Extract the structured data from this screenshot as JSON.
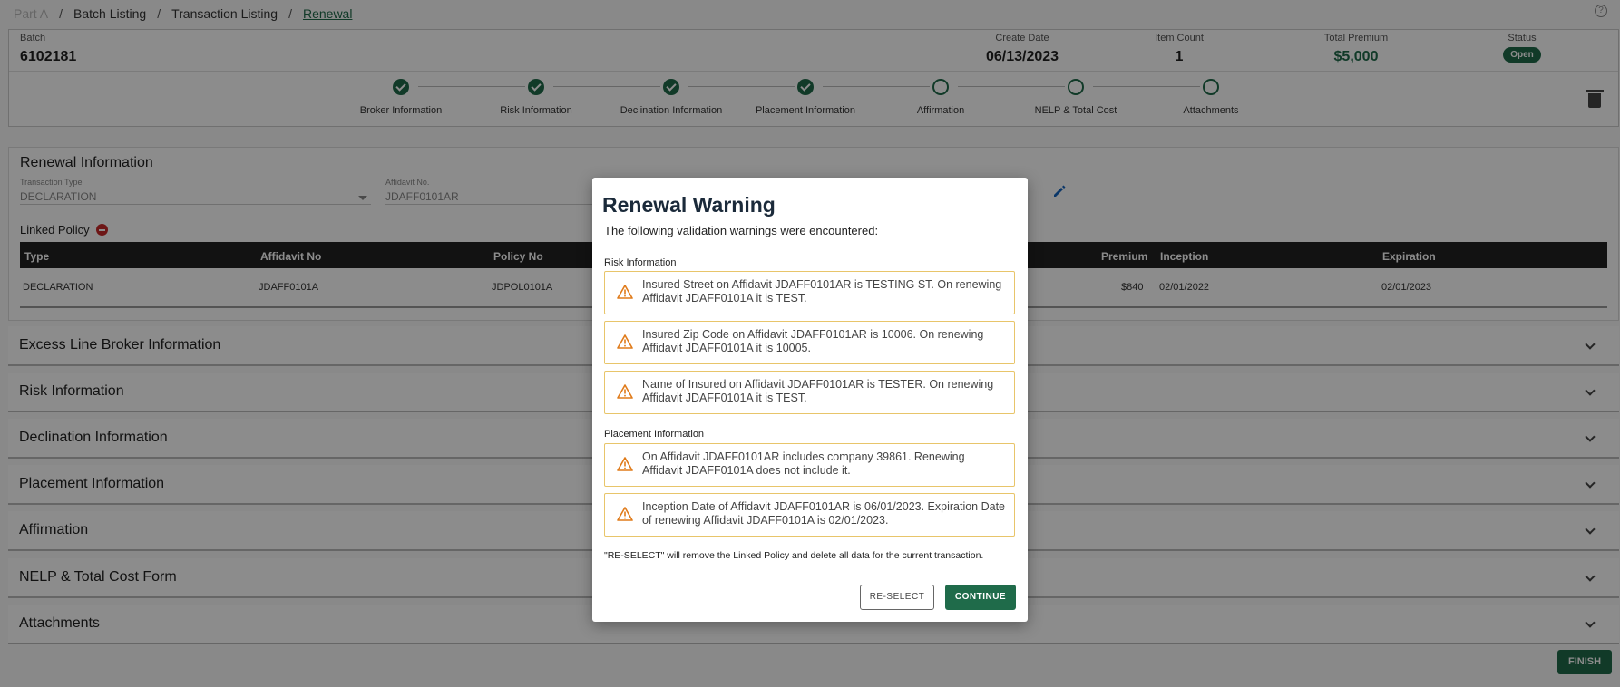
{
  "breadcrumb": {
    "items": [
      "Part A",
      "Batch Listing",
      "Transaction Listing",
      "Renewal"
    ],
    "separator": "/"
  },
  "help_icon": "?",
  "batch": {
    "label": "Batch",
    "value": "6102181",
    "create_date_label": "Create Date",
    "create_date": "06/13/2023",
    "item_count_label": "Item Count",
    "item_count": "1",
    "total_premium_label": "Total Premium",
    "total_premium": "$5,000",
    "status_label": "Status",
    "status": "Open"
  },
  "stepper": {
    "steps": [
      {
        "label": "Broker Information",
        "state": "done"
      },
      {
        "label": "Risk Information",
        "state": "done"
      },
      {
        "label": "Declination Information",
        "state": "done"
      },
      {
        "label": "Placement Information",
        "state": "done"
      },
      {
        "label": "Affirmation",
        "state": "todo"
      },
      {
        "label": "NELP & Total Cost",
        "state": "todo"
      },
      {
        "label": "Attachments",
        "state": "todo"
      }
    ]
  },
  "renewal": {
    "title": "Renewal Information",
    "transaction_type_label": "Transaction Type",
    "transaction_type": "DECLARATION",
    "affidavit_label": "Affidavit No.",
    "affidavit": "JDAFF0101AR",
    "linked_policy_label": "Linked Policy",
    "table": {
      "headers": {
        "type": "Type",
        "affidavit": "Affidavit No",
        "policy": "Policy No",
        "premium": "Premium",
        "inception": "Inception",
        "expiration": "Expiration"
      },
      "row": {
        "type": "DECLARATION",
        "affidavit": "JDAFF0101A",
        "policy": "JDPOL0101A",
        "premium": "$840",
        "inception": "02/01/2022",
        "expiration": "02/01/2023"
      }
    }
  },
  "accordions": [
    "Excess Line Broker Information",
    "Risk Information",
    "Declination Information",
    "Placement Information",
    "Affirmation",
    "NELP & Total Cost Form",
    "Attachments"
  ],
  "finish_label": "FINISH",
  "modal": {
    "title": "Renewal Warning",
    "subtitle": "The following validation warnings were encountered:",
    "risk_section": "Risk Information",
    "risk_warnings": [
      "Insured Street on Affidavit JDAFF0101AR is TESTING ST. On renewing Affidavit JDAFF0101A it is TEST.",
      "Insured Zip Code on Affidavit JDAFF0101AR is 10006. On renewing Affidavit JDAFF0101A it is 10005.",
      "Name of Insured on Affidavit JDAFF0101AR is TESTER. On renewing Affidavit JDAFF0101A it is TEST."
    ],
    "placement_section": "Placement Information",
    "placement_warnings": [
      "On Affidavit JDAFF0101AR includes company 39861. Renewing Affidavit JDAFF0101A does not include it.",
      "Inception Date of Affidavit JDAFF0101AR is 06/01/2023. Expiration Date of renewing Affidavit JDAFF0101A is 02/01/2023."
    ],
    "note": "\"RE-SELECT\" will remove the Linked Policy and delete all data for the current transaction.",
    "reselect_label": "RE-SELECT",
    "continue_label": "CONTINUE"
  },
  "colors": {
    "primary_green": "#1f6b4a",
    "warning_orange": "#e07b1a",
    "warning_border": "#e8c56a",
    "delete_red": "#c62828",
    "table_header": "#212121"
  }
}
